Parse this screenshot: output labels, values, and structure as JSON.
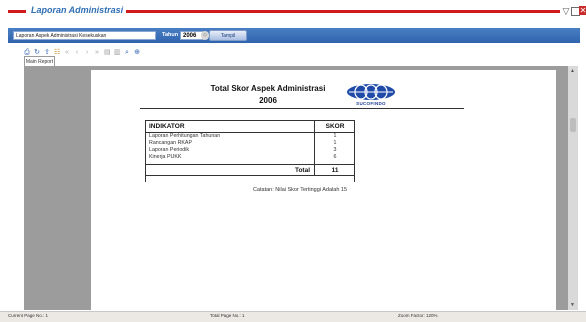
{
  "window": {
    "title": "Laporan Administrasi",
    "accent_color": "#cf1b1b",
    "title_color": "#2f6fb4"
  },
  "filter": {
    "report_type": "Laporan Aspek Administrasi Kesekuskan",
    "year_label": "Tahun",
    "year_value": "2006",
    "show_button": "Tampil"
  },
  "toolbar": {
    "icons": [
      "print-icon",
      "refresh-icon",
      "export-icon",
      "tree-icon",
      "first-page-icon",
      "prev-page-icon",
      "next-page-icon",
      "last-page-icon",
      "copy-icon",
      "page-setup-icon",
      "search-icon",
      "zoom-icon"
    ]
  },
  "tabs": {
    "main_report": "Main Report"
  },
  "report": {
    "title": "Total Skor Aspek Administrasi",
    "year": "2006",
    "logo_text": "SUCOFINDO",
    "columns": {
      "indicator": "INDIKATOR",
      "score": "SKOR"
    },
    "rows": [
      {
        "indicator": "Laporan Perhitungan Tahunan",
        "score": "1"
      },
      {
        "indicator": "Rancangan RKAP",
        "score": "1"
      },
      {
        "indicator": "Laporan Periodik",
        "score": "3"
      },
      {
        "indicator": "Kinerja PUKK",
        "score": "6"
      }
    ],
    "total_label": "Total",
    "total_value": "11",
    "note": "Catatan: Nilai Skor Tertinggi Adalah 15"
  },
  "status": {
    "current_page": "Current Page No.: 1",
    "total_page": "Total Page No.: 1",
    "zoom": "Zoom Factor: 120%"
  }
}
